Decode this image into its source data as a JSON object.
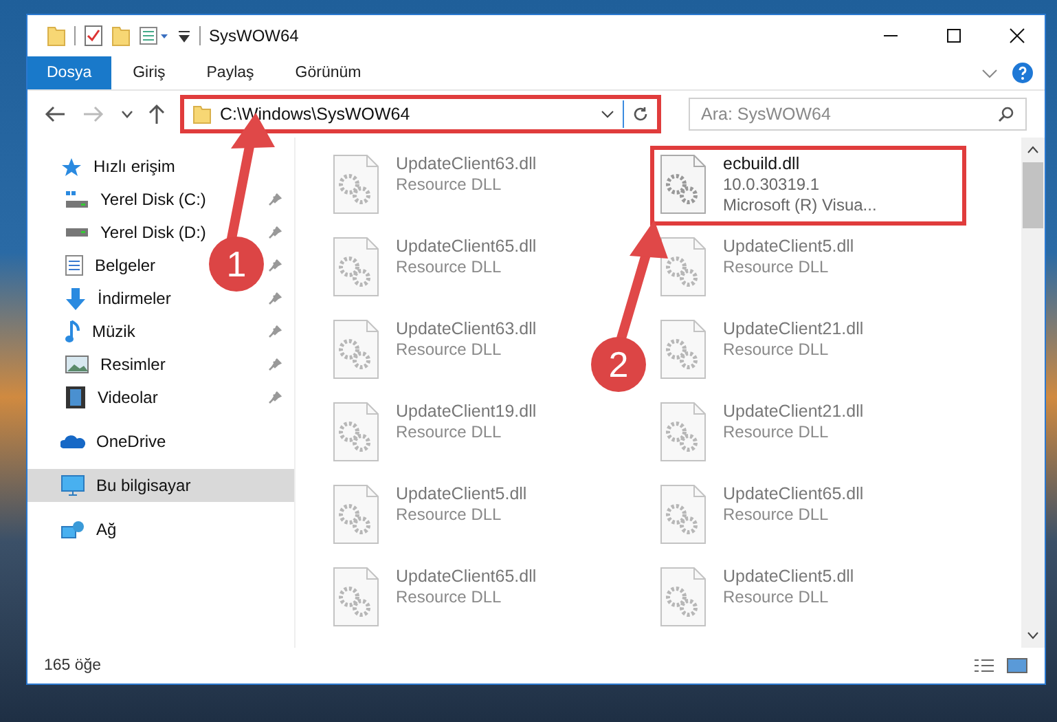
{
  "window": {
    "title": "SysWOW64"
  },
  "ribbon_tabs": [
    {
      "label": "Dosya",
      "kind": "file"
    },
    {
      "label": "Giriş",
      "kind": "tab"
    },
    {
      "label": "Paylaş",
      "kind": "tab"
    },
    {
      "label": "Görünüm",
      "kind": "tab"
    }
  ],
  "nav_buttons": [
    {
      "kind": "back",
      "disabled": false
    },
    {
      "kind": "forward",
      "disabled": true
    },
    {
      "kind": "recent",
      "disabled": false
    },
    {
      "kind": "up",
      "disabled": false
    }
  ],
  "address": {
    "path": "C:\\Windows\\SysWOW64",
    "highlighted": true
  },
  "search": {
    "placeholder": "Ara: SysWOW64"
  },
  "sidebar": {
    "items": [
      {
        "label": "Hızlı erişim",
        "kind": "quick-access",
        "selected": false,
        "children": [
          {
            "label": "Yerel Disk (C:)",
            "kind": "system-drive",
            "pinned": true,
            "selected": false
          },
          {
            "label": "Yerel Disk (D:)",
            "kind": "drive",
            "pinned": true,
            "selected": false
          },
          {
            "label": "Belgeler",
            "kind": "documents",
            "pinned": true,
            "selected": false
          },
          {
            "label": "İndirmeler",
            "kind": "downloads",
            "pinned": true,
            "selected": false
          },
          {
            "label": "Müzik",
            "kind": "music",
            "pinned": true,
            "selected": false
          },
          {
            "label": "Resimler",
            "kind": "pictures",
            "pinned": true,
            "selected": false
          },
          {
            "label": "Videolar",
            "kind": "videos",
            "pinned": true,
            "selected": false
          }
        ]
      },
      {
        "label": "OneDrive",
        "kind": "cloud",
        "selected": false
      },
      {
        "label": "Bu bilgisayar",
        "kind": "computer",
        "selected": true
      },
      {
        "label": "Ağ",
        "kind": "network",
        "selected": false
      }
    ]
  },
  "files": [
    {
      "name": "UpdateClient63.dll",
      "details": [
        "Resource DLL"
      ],
      "blurred": true,
      "highlighted": false
    },
    {
      "name": "ecbuild.dll",
      "details": [
        "10.0.30319.1",
        "Microsoft (R) Visua..."
      ],
      "blurred": false,
      "highlighted": true
    },
    {
      "name": "UpdateClient65.dll",
      "details": [
        "Resource DLL"
      ],
      "blurred": true,
      "highlighted": false
    },
    {
      "name": "UpdateClient5.dll",
      "details": [
        "Resource DLL"
      ],
      "blurred": true,
      "highlighted": false
    },
    {
      "name": "UpdateClient63.dll",
      "details": [
        "Resource DLL"
      ],
      "blurred": true,
      "highlighted": false
    },
    {
      "name": "UpdateClient21.dll",
      "details": [
        "Resource DLL"
      ],
      "blurred": true,
      "highlighted": false
    },
    {
      "name": "UpdateClient19.dll",
      "details": [
        "Resource DLL"
      ],
      "blurred": true,
      "highlighted": false
    },
    {
      "name": "UpdateClient21.dll",
      "details": [
        "Resource DLL"
      ],
      "blurred": true,
      "highlighted": false
    },
    {
      "name": "UpdateClient5.dll",
      "details": [
        "Resource DLL"
      ],
      "blurred": true,
      "highlighted": false
    },
    {
      "name": "UpdateClient65.dll",
      "details": [
        "Resource DLL"
      ],
      "blurred": true,
      "highlighted": false
    },
    {
      "name": "UpdateClient65.dll",
      "details": [
        "Resource DLL"
      ],
      "blurred": true,
      "highlighted": false
    },
    {
      "name": "UpdateClient5.dll",
      "details": [
        "Resource DLL"
      ],
      "blurred": true,
      "highlighted": false
    }
  ],
  "annotations": [
    {
      "number": "1"
    },
    {
      "number": "2"
    }
  ],
  "status_bar": {
    "item_count": "165 öğe"
  }
}
